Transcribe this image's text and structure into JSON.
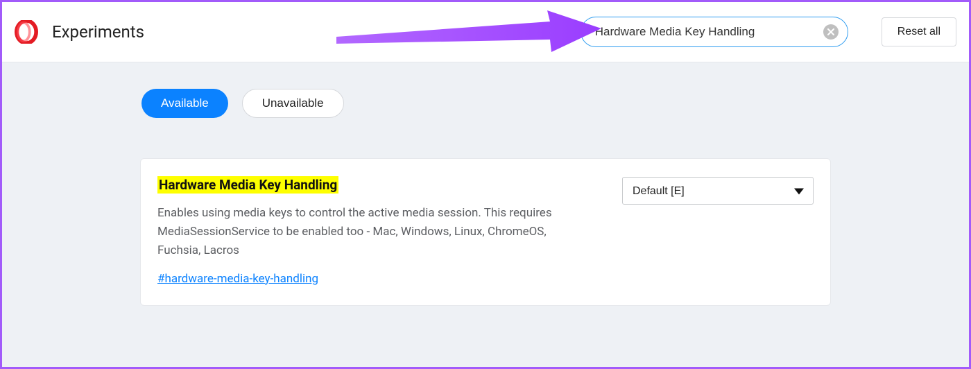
{
  "header": {
    "title": "Experiments",
    "search_value": "Hardware Media Key Handling",
    "reset_label": "Reset all"
  },
  "tabs": {
    "available": "Available",
    "unavailable": "Unavailable"
  },
  "flag": {
    "title": "Hardware Media Key Handling",
    "description": "Enables using media keys to control the active media session. This requires MediaSessionService to be enabled too - Mac, Windows, Linux, ChromeOS, Fuchsia, Lacros",
    "link": "#hardware-media-key-handling",
    "selected_option": "Default [E]"
  }
}
